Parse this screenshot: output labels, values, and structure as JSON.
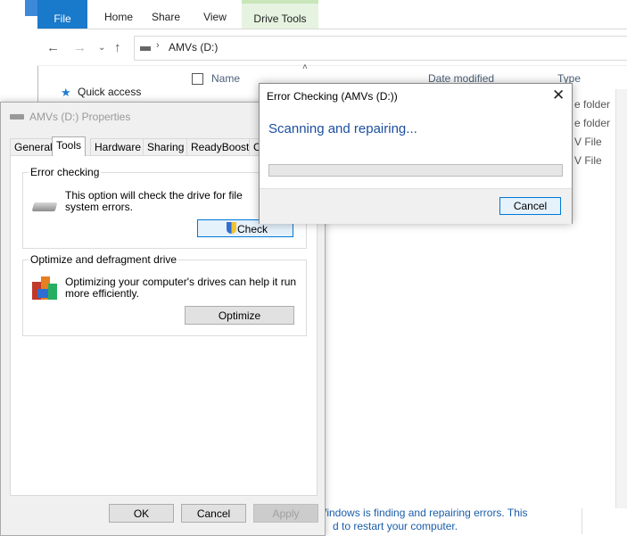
{
  "explorer": {
    "ribbon_tabs": [
      "File",
      "Home",
      "Share",
      "View",
      "Drive Tools"
    ],
    "address": "AMVs (D:)",
    "columns": {
      "name": "Name",
      "date": "Date modified",
      "type": "Type"
    },
    "quick_access": "Quick access",
    "types": [
      "e folder",
      "e folder",
      "V File",
      "V File"
    ],
    "bottom_text_1": "e Windows is finding and repairing errors. This",
    "bottom_text_2": "d to restart your computer."
  },
  "properties": {
    "title": "AMVs (D:) Properties",
    "tabs": [
      "General",
      "Tools",
      "Hardware",
      "Sharing",
      "ReadyBoost",
      "C"
    ],
    "active_tab": "Tools",
    "error_checking": {
      "title": "Error checking",
      "description_1": "This option will check the drive for file",
      "description_2": "system errors.",
      "button": "Check"
    },
    "optimize": {
      "title": "Optimize and defragment drive",
      "description_1": "Optimizing your computer's drives can help it run",
      "description_2": "more efficiently.",
      "button": "Optimize"
    },
    "footer": {
      "ok": "OK",
      "cancel": "Cancel",
      "apply": "Apply"
    }
  },
  "error_dialog": {
    "title": "Error Checking (AMVs (D:))",
    "status": "Scanning and repairing...",
    "progress": 0,
    "cancel": "Cancel"
  },
  "colors": {
    "accent": "#1979ca",
    "status_text": "#1c4fa1",
    "focus": "#0078d7"
  }
}
